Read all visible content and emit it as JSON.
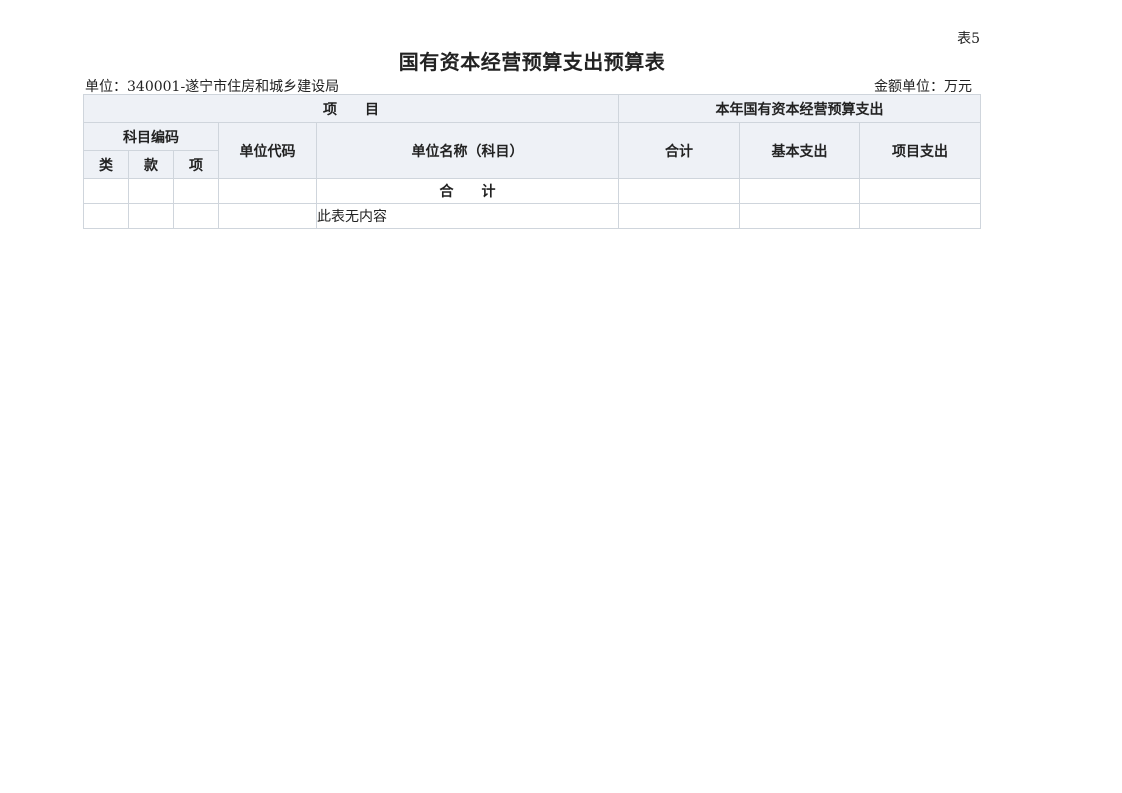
{
  "header": {
    "table_no": "表5",
    "title": "国有资本经营预算支出预算表",
    "unit_label": "单位：340001-遂宁市住房和城乡建设局",
    "amount_unit_label": "金额单位：万元"
  },
  "table": {
    "group_item": "项　　目",
    "group_budget": "本年国有资本经营预算支出",
    "subject_code": "科目编码",
    "col_class": "类",
    "col_section": "款",
    "col_item": "项",
    "col_unit_code": "单位代码",
    "col_unit_name": "单位名称（科目）",
    "col_total": "合计",
    "col_basic": "基本支出",
    "col_project": "项目支出",
    "total_row_label": "合　　计",
    "empty_note": "此表无内容"
  }
}
